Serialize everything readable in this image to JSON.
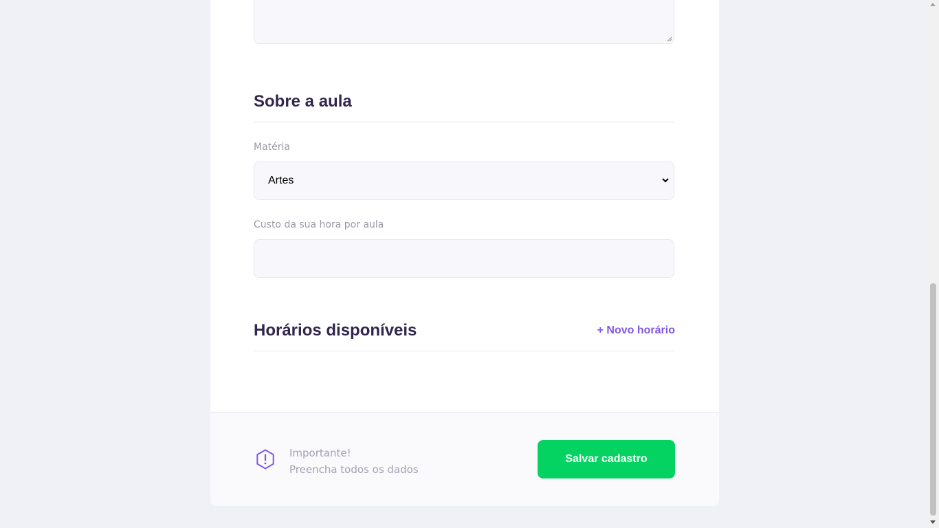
{
  "form": {
    "textarea": {
      "value": ""
    },
    "about_class": {
      "title": "Sobre a aula",
      "subject": {
        "label": "Matéria",
        "selected": "Artes"
      },
      "cost": {
        "label": "Custo da sua hora por aula",
        "value": ""
      }
    },
    "schedules": {
      "title": "Horários disponíveis",
      "new_schedule_label": "+ Novo horário"
    }
  },
  "footer": {
    "notice_title": "Importante!",
    "notice_text": "Preencha todos os dados",
    "save_label": "Salvar cadastro",
    "warning_icon": "warning-hexagon-icon"
  },
  "colors": {
    "title": "#32264d",
    "accent": "#8257e5",
    "success": "#04d361",
    "muted": "#9c98a6",
    "background": "#f0f0f7"
  }
}
